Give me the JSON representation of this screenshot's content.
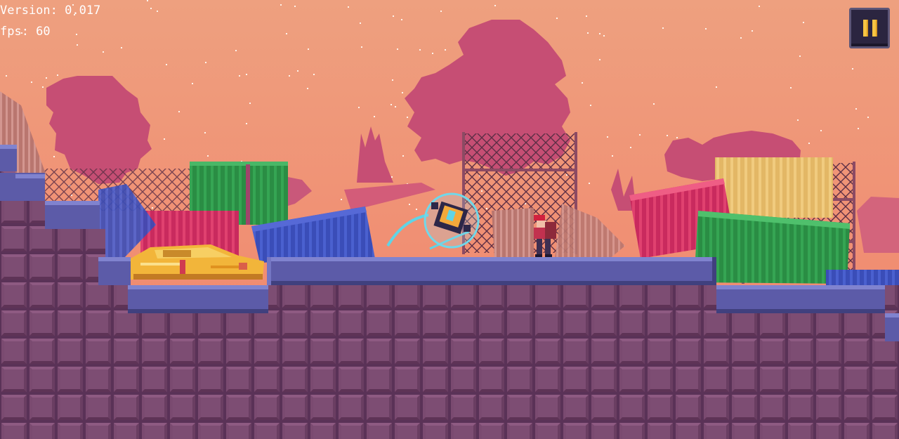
{
  "hud": {
    "version_text": "Version: 0.017",
    "fps_text": "fps: 60",
    "pause_icon": "pause-icon"
  },
  "colors": {
    "sky_top": "#f0a37f",
    "sky_bottom": "#f08a6c",
    "silhouette": "#c94f75",
    "silhouette_light": "#d9667c",
    "ground_brick": "#7a4a70",
    "ground_brick_dark": "#4f2b4b",
    "platform_top": "#6b6cb8",
    "platform_edge": "#4b4a8f",
    "container_blue": "#3f54c2",
    "container_green": "#2f9a4b",
    "container_red": "#d12d60",
    "container_yellow": "#e8c16b",
    "car_yellow": "#f3b93b",
    "bubble_cyan": "#5fd4e6",
    "pause_icon": "#f6c543"
  },
  "objects": {
    "player": "player-character",
    "drone": "bubble-drone",
    "vehicle": "wrecked-yellow-car"
  }
}
